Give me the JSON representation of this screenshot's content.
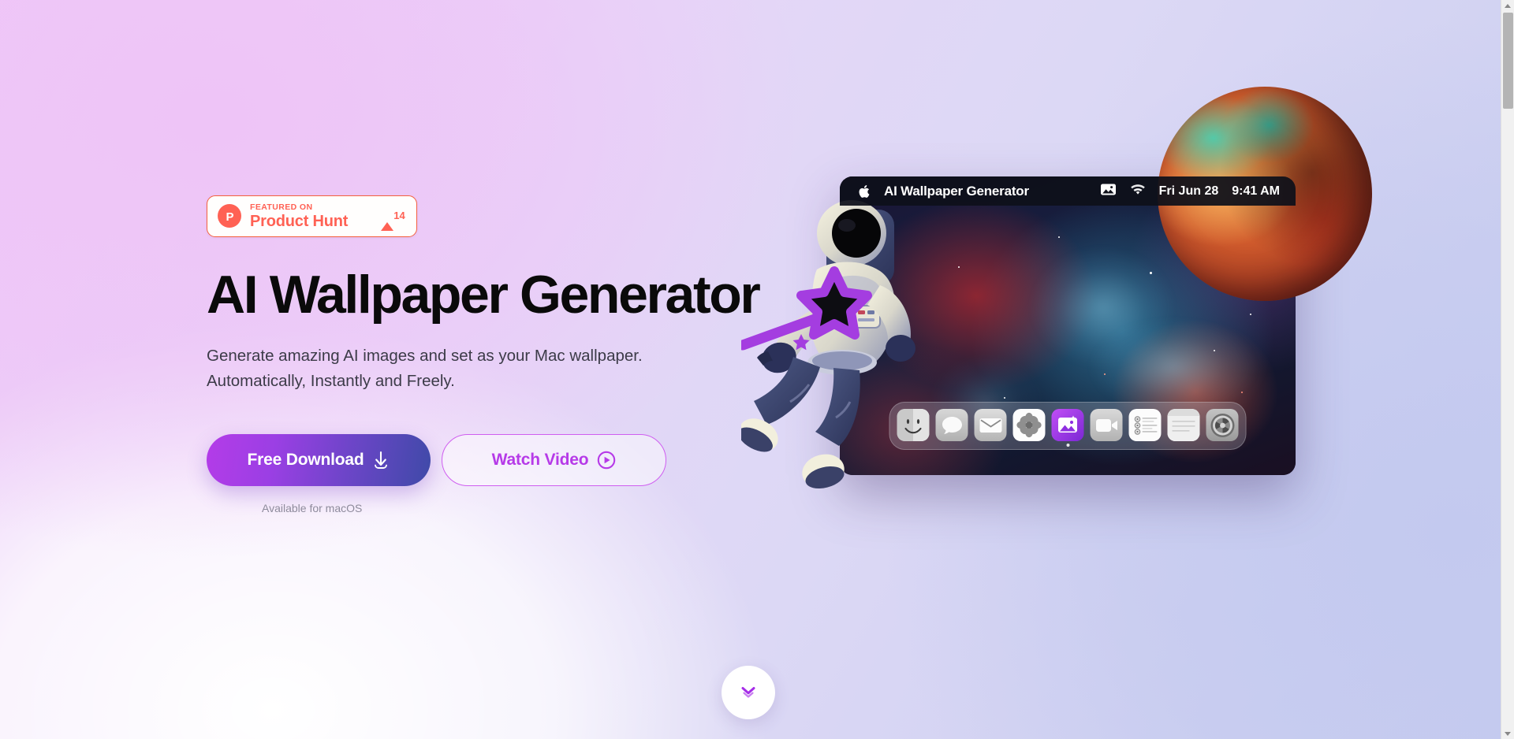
{
  "product_hunt_badge": {
    "featured_label": "FEATURED ON",
    "name": "Product Hunt",
    "upvote_count": "14",
    "logo_letter": "P"
  },
  "hero": {
    "headline": "AI Wallpaper Generator",
    "subtitle_line1": "Generate amazing AI images and set as your Mac wallpaper.",
    "subtitle_line2": "Automatically, Instantly and Freely.",
    "primary_button": "Free Download",
    "secondary_button": "Watch Video",
    "availability_note": "Available for macOS"
  },
  "mac_window": {
    "menubar": {
      "app_title": "AI Wallpaper Generator",
      "date": "Fri Jun 28",
      "time": "9:41 AM",
      "apple_icon": "apple-logo-icon",
      "photos_status_icon": "photos-menubar-icon",
      "wifi_icon": "wifi-icon"
    },
    "dock": {
      "items": [
        {
          "name": "Finder",
          "icon": "finder-icon",
          "active": false
        },
        {
          "name": "Messages",
          "icon": "messages-icon",
          "active": false
        },
        {
          "name": "Mail",
          "icon": "mail-icon",
          "active": false
        },
        {
          "name": "Photos",
          "icon": "photos-icon",
          "active": false
        },
        {
          "name": "AI Wallpaper Generator",
          "icon": "ai-wallpaper-icon",
          "active": true
        },
        {
          "name": "FaceTime",
          "icon": "facetime-icon",
          "active": false
        },
        {
          "name": "Reminders",
          "icon": "reminders-icon",
          "active": false
        },
        {
          "name": "Notes",
          "icon": "notes-icon",
          "active": false
        },
        {
          "name": "System Settings",
          "icon": "settings-gear-icon",
          "active": false
        }
      ]
    }
  },
  "decorations": {
    "planet": "planet-illustration",
    "astronaut": "astronaut-illustration",
    "magic_wand": "magic-wand-icon",
    "scroll_down": "chevron-double-down-icon"
  },
  "colors": {
    "accent_purple": "#b63ae8",
    "accent_blue": "#3f4aa8",
    "product_hunt_red": "#ff6154",
    "headline_black": "#0a0a0a",
    "subtitle_gray": "#3c3b48",
    "note_gray": "#8e8b9c"
  }
}
